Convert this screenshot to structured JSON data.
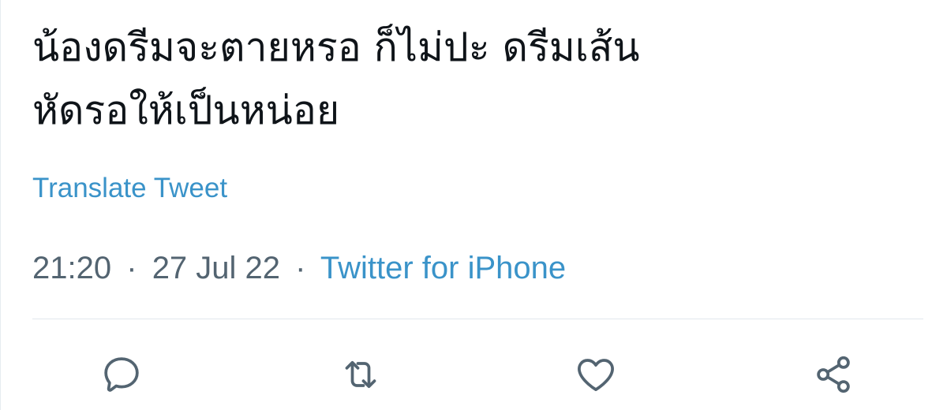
{
  "tweet": {
    "text_lines": [
      "น้องดรีมจะตายหรอ ก็ไม่ปะ ดรีมเส้น",
      "หัดรอให้เป็นหน่อย"
    ],
    "translate_label": "Translate Tweet",
    "time": "21:20",
    "date": "27 Jul 22",
    "separator": "·",
    "source": "Twitter for iPhone"
  },
  "actions": {
    "reply_icon": "reply-icon",
    "retweet_icon": "retweet-icon",
    "like_icon": "heart-icon",
    "share_icon": "share-icon"
  },
  "colors": {
    "text": "#0f1419",
    "secondary": "#536471",
    "link": "#3a93c9",
    "icon": "#536471",
    "divider": "#e1e8ed"
  }
}
